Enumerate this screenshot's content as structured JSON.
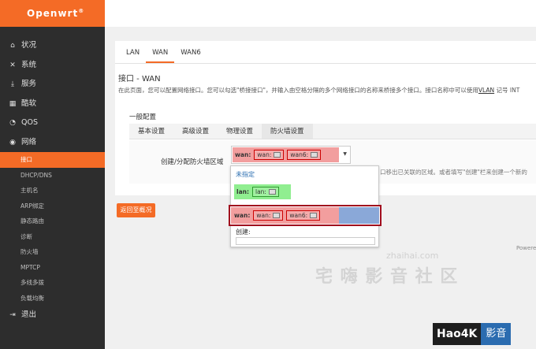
{
  "brand": "Openwrt",
  "brand_mark": "®",
  "sidebar": {
    "items": [
      {
        "label": "状况",
        "icon": "home-icon"
      },
      {
        "label": "系统",
        "icon": "tools-icon"
      },
      {
        "label": "服务",
        "icon": "download-icon"
      },
      {
        "label": "酷软",
        "icon": "calendar-icon"
      },
      {
        "label": "QOS",
        "icon": "gauge-icon"
      },
      {
        "label": "网络",
        "icon": "globe-icon"
      }
    ],
    "sub_items": [
      "接口",
      "DHCP/DNS",
      "主机名",
      "ARP绑定",
      "静态路由",
      "诊断",
      "防火墙",
      "MPTCP",
      "多线多拨",
      "负载均衡"
    ],
    "logout": "退出"
  },
  "tabs": [
    "LAN",
    "WAN",
    "WAN6"
  ],
  "page": {
    "title": "接口 - WAN",
    "desc_pre": "在此页面，您可以配置网络接口。您可以勾选\"桥接接口\"，并输入由空格分隔的多个网络接口的名称来桥接多个接口。接口名称中可以使用",
    "desc_link": "VLAN",
    "desc_post": " 记号 INT",
    "group_title": "一般配置"
  },
  "subtabs": [
    "基本设置",
    "高级设置",
    "物理设置",
    "防火墙设置"
  ],
  "form": {
    "label": "创建/分配防火墙区域",
    "help": "口移出已关联的区域。或者填写\"创建\"栏来创建一个新的"
  },
  "zone_select": {
    "selected_zone": "wan:",
    "selected_nets": [
      "wan:",
      "wan6:"
    ],
    "options": {
      "none": "未指定",
      "lan_zone": "lan:",
      "lan_nets": [
        "lan:"
      ],
      "wan_zone": "wan:",
      "wan_nets": [
        "wan:",
        "wan6:"
      ],
      "create_label": "创建:"
    }
  },
  "back_button": "返回至概况",
  "powered": "Powere",
  "watermark": {
    "small": "zhaihai.com",
    "big": "宅 嗨 影 音 社 区"
  },
  "badge": {
    "left": "Hao4K",
    "right": "影音"
  },
  "colors": {
    "accent": "#f46b26",
    "sidebar_bg": "#2d2d2d",
    "wan_zone": "#f29e9e",
    "lan_zone": "#90ee90",
    "highlight": "#a10d1e"
  }
}
